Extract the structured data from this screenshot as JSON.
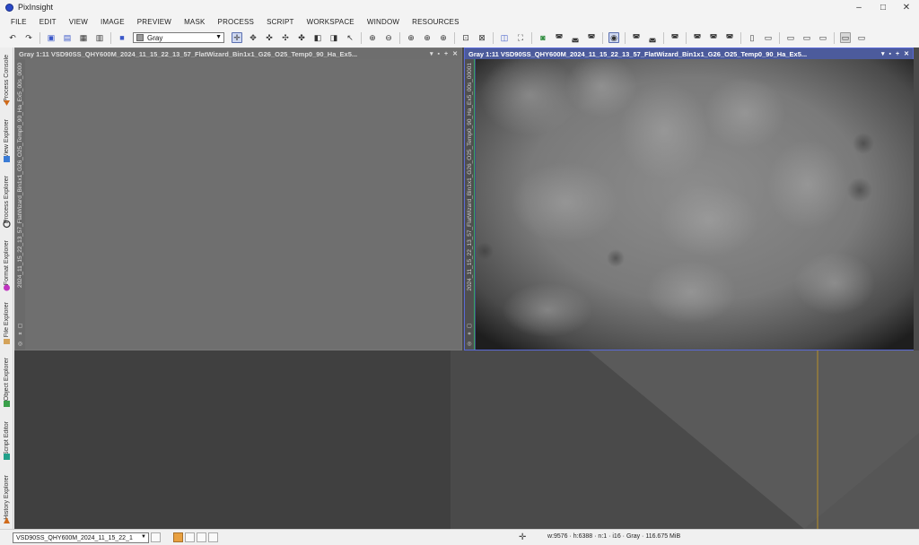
{
  "app": {
    "title": "PixInsight",
    "colors": {
      "accent": "#2a49c7",
      "active_window": "#4c5b9c"
    }
  },
  "window_controls": {
    "minimize": "–",
    "maximize": "□",
    "close": "✕"
  },
  "menu": [
    "FILE",
    "EDIT",
    "VIEW",
    "IMAGE",
    "PREVIEW",
    "MASK",
    "PROCESS",
    "SCRIPT",
    "WORKSPACE",
    "WINDOW",
    "RESOURCES"
  ],
  "toolbar": {
    "channel_select": {
      "value": "Gray"
    }
  },
  "dock": {
    "tabs": [
      "Process Console",
      "View Explorer",
      "Process Explorer",
      "Format Explorer",
      "File Explorer",
      "Object Explorer",
      "Script Editor",
      "History Explorer"
    ]
  },
  "image_windows": [
    {
      "title": "Gray 1:11 VSD90SS_QHY600M_2024_11_15_22_13_57_FlatWizard_Bin1x1_G26_O25_Temp0_90_Ha_Ex5...",
      "side_label": "2024_11_15_22_13_57_FlatWizard_Bin1x1_G26_O25_Temp0_90_Ha_Ex5_00s_0000",
      "controls": {
        "shade": "▾",
        "minimize": "▪",
        "maximize": "+",
        "close": "✕"
      }
    },
    {
      "title": "Gray 1:11 VSD90SS_QHY600M_2024_11_15_22_13_57_FlatWizard_Bin1x1_G26_O25_Temp0_90_Ha_Ex5...",
      "side_label": "2024_11_15_22_13_57_FlatWizard_Bin1x1_G26_O25_Temp0_90_Ha_Ex5_00s_00001",
      "controls": {
        "shade": "▾",
        "minimize": "▪",
        "maximize": "+",
        "close": "✕"
      }
    }
  ],
  "statusbar": {
    "view_select": "VSD90SS_QHY600M_2024_11_15_22_1",
    "image_info": "w:9576 · h:6388 · n:1 · i16 · Gray · 116.675 MiB"
  }
}
